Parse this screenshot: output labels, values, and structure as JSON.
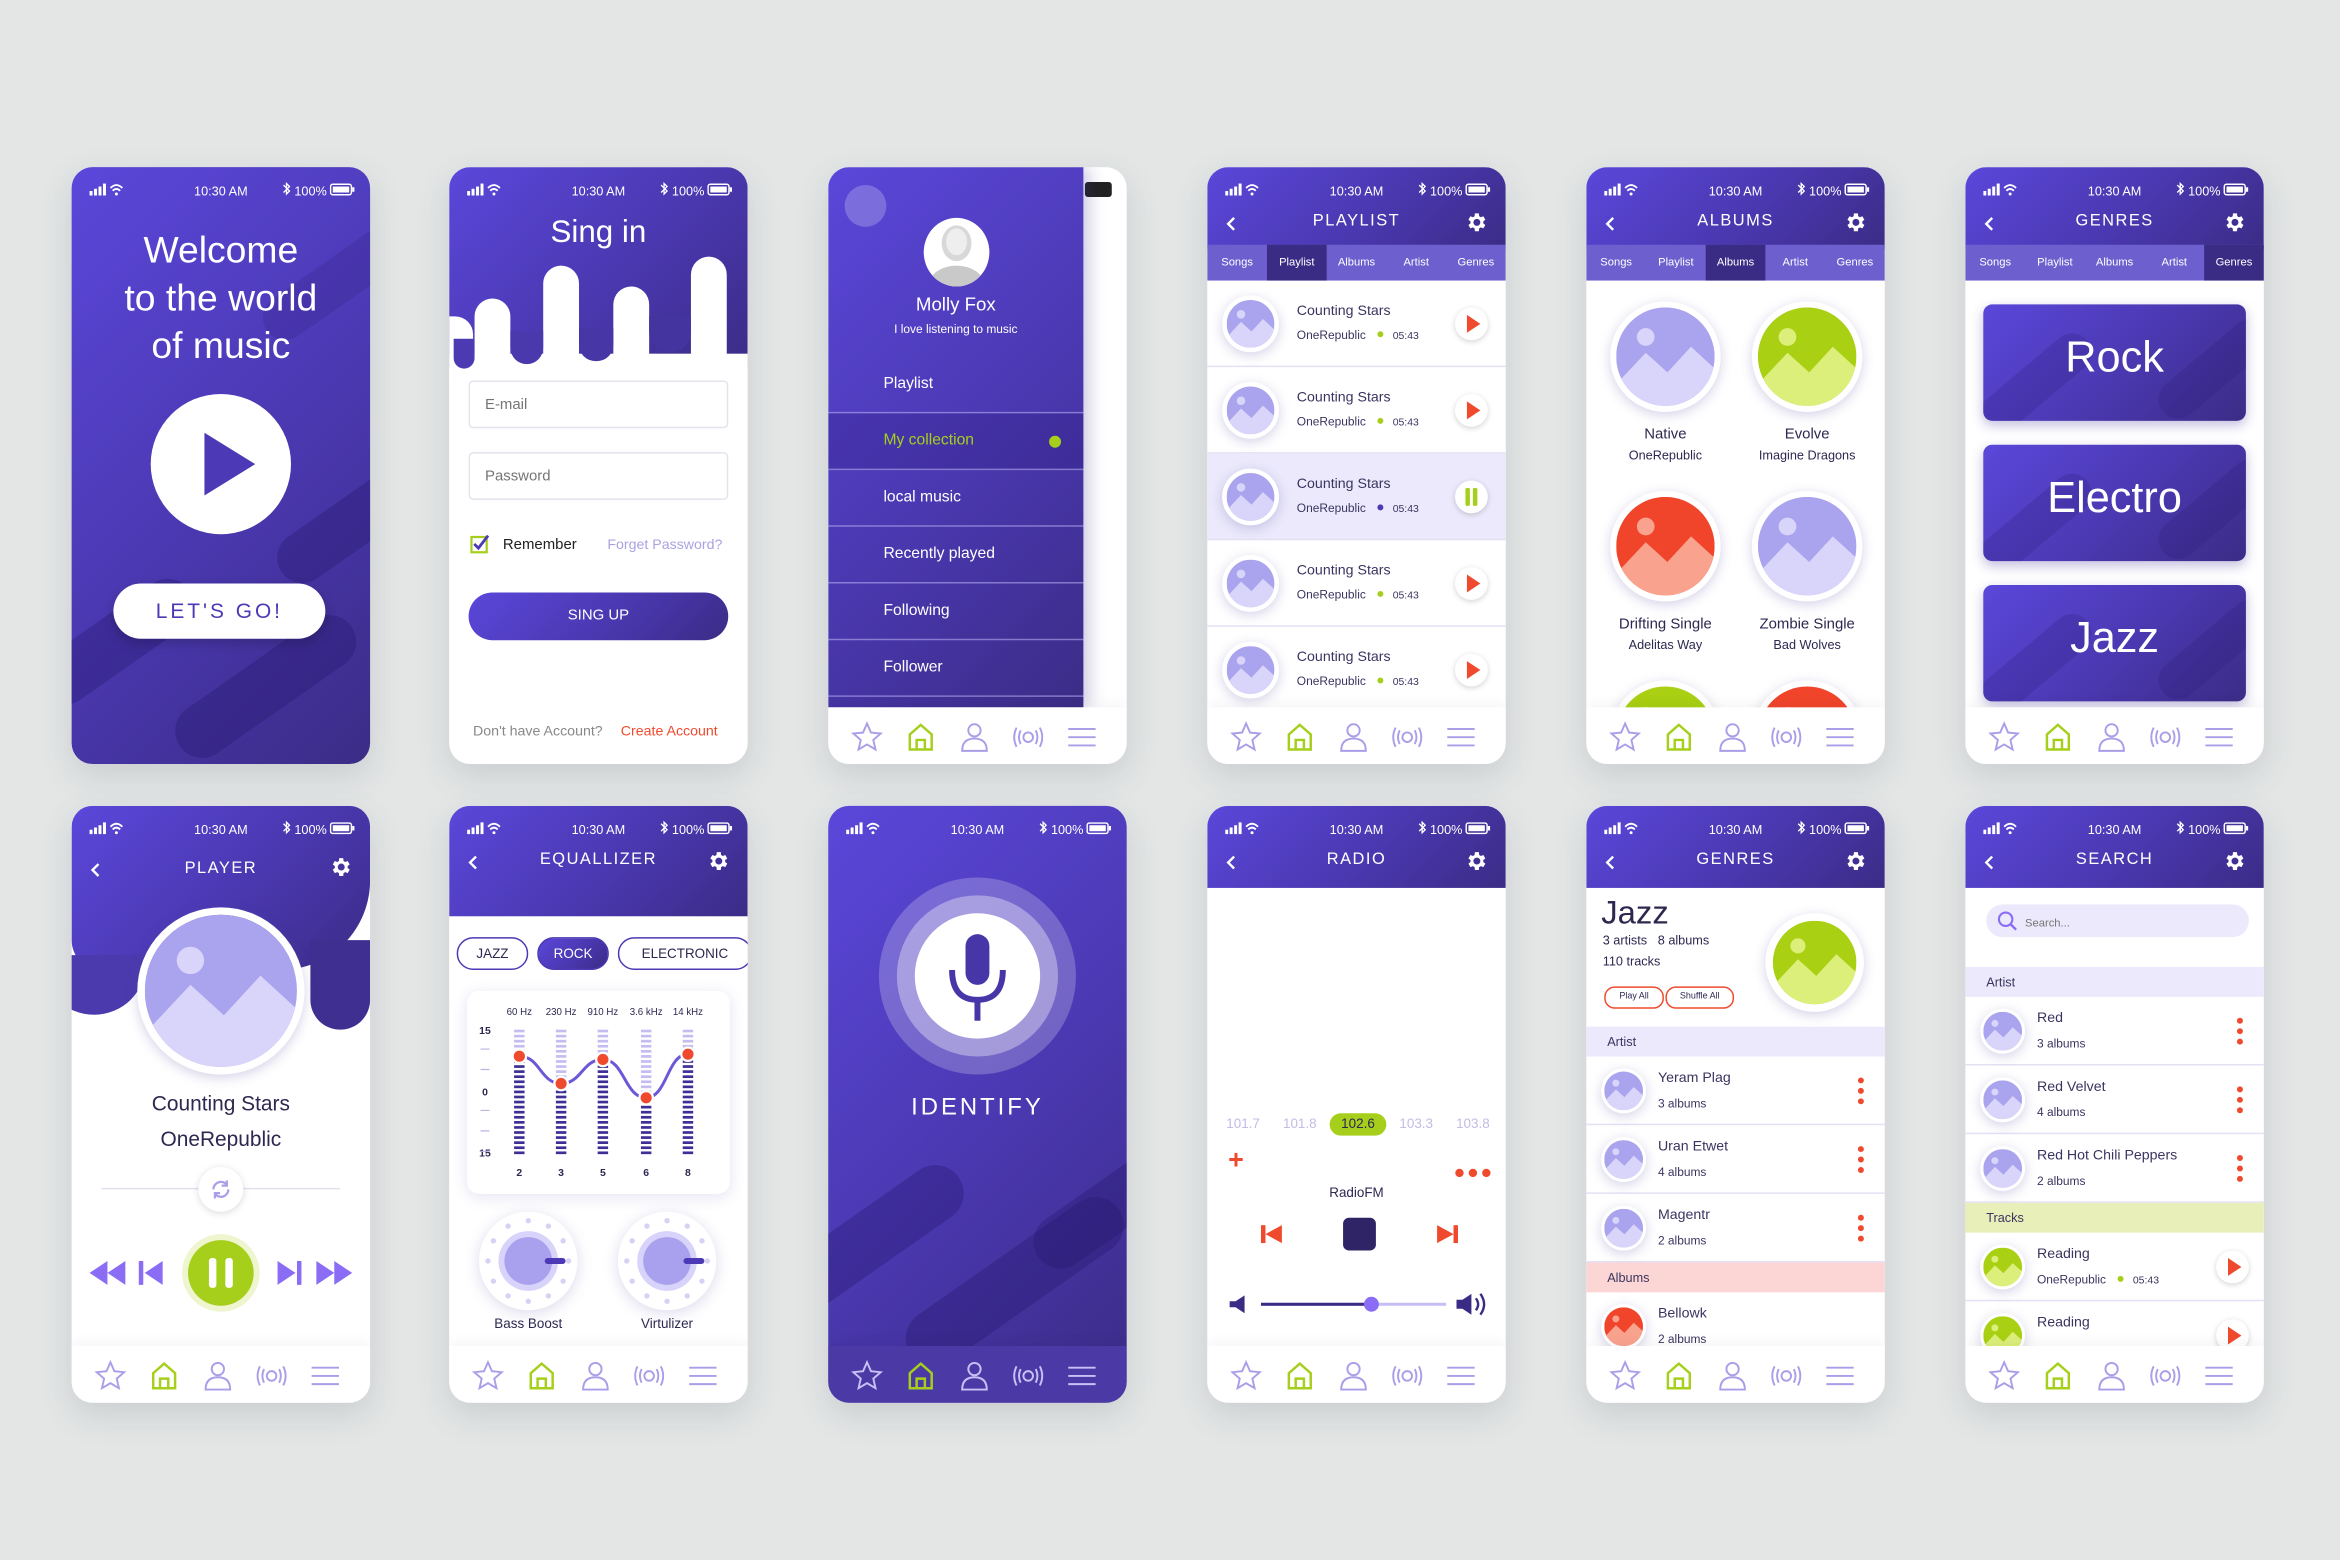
{
  "status": {
    "time": "10:30 AM",
    "battery": "100%"
  },
  "colors": {
    "purple": "#5443c8",
    "dark_purple": "#3a2b85",
    "green": "#a6cf1c",
    "red": "#f04a2e",
    "lavender": "#ebe9fb"
  },
  "palettes": {
    "lavender": [
      "#aaa3ee",
      "#d8d4fa"
    ],
    "green": [
      "#a9d012",
      "#dcef7a"
    ],
    "red": [
      "#f0452b",
      "#f9a38f"
    ]
  },
  "nav_icons": [
    "star-icon",
    "home-icon",
    "user-icon",
    "radio-icon",
    "menu-icon"
  ],
  "welcome": {
    "title_lines": [
      "Welcome",
      "to the world",
      "of music"
    ],
    "cta": "LET'S GO!"
  },
  "signin": {
    "title": "Sing in",
    "email_placeholder": "E-mail",
    "password_placeholder": "Password",
    "remember": "Remember",
    "remember_checked": true,
    "forgot": "Forget Password?",
    "submit": "SING UP",
    "no_account": "Don't have Account?",
    "create": "Create Account"
  },
  "menu": {
    "name": "Molly Fox",
    "bio": "I love listening to music",
    "items": [
      "Playlist",
      "My collection",
      "local music",
      "Recently played",
      "Following",
      "Follower"
    ],
    "active_index": 1
  },
  "tabs": [
    "Songs",
    "Playlist",
    "Albums",
    "Artist",
    "Genres"
  ],
  "playlist": {
    "title": "PLAYLIST",
    "active_tab": 1,
    "tracks": [
      {
        "title": "Counting Stars",
        "artist": "OneRepublic",
        "duration": "05:43",
        "playing": false
      },
      {
        "title": "Counting Stars",
        "artist": "OneRepublic",
        "duration": "05:43",
        "playing": false
      },
      {
        "title": "Counting Stars",
        "artist": "OneRepublic",
        "duration": "05:43",
        "playing": true
      },
      {
        "title": "Counting Stars",
        "artist": "OneRepublic",
        "duration": "05:43",
        "playing": false
      },
      {
        "title": "Counting Stars",
        "artist": "OneRepublic",
        "duration": "05:43",
        "playing": false
      }
    ]
  },
  "albums": {
    "title": "ALBUMS",
    "active_tab": 2,
    "items": [
      {
        "name": "Native",
        "artist": "OneRepublic",
        "palette": "lavender"
      },
      {
        "name": "Evolve",
        "artist": "Imagine Dragons",
        "palette": "green"
      },
      {
        "name": "Drifting Single",
        "artist": "Adelitas Way",
        "palette": "red"
      },
      {
        "name": "Zombie Single",
        "artist": "Bad Wolves",
        "palette": "lavender"
      },
      {
        "name": "",
        "artist": "",
        "palette": "green"
      },
      {
        "name": "",
        "artist": "",
        "palette": "red"
      }
    ]
  },
  "genres": {
    "title": "GENRES",
    "active_tab": 4,
    "items": [
      "Rock",
      "Electro",
      "Jazz"
    ]
  },
  "player": {
    "title": "PLAYER",
    "song": "Counting Stars",
    "artist": "OneRepublic"
  },
  "equalizer": {
    "title": "EQUALLIZER",
    "presets": [
      "JAZZ",
      "ROCK",
      "ELECTRONIC"
    ],
    "active_preset": "ROCK",
    "scale_labels": [
      "15",
      "0",
      "15"
    ],
    "range": [
      -15,
      15
    ],
    "bands": [
      {
        "freq": "60 Hz",
        "label": "2",
        "level": 8.5
      },
      {
        "freq": "230 Hz",
        "label": "3",
        "level": 1.8
      },
      {
        "freq": "910 Hz",
        "label": "5",
        "level": 7.7
      },
      {
        "freq": "3.6 kHz",
        "label": "6",
        "level": -1.7
      },
      {
        "freq": "14 kHz",
        "label": "8",
        "level": 9
      }
    ],
    "knobs": [
      "Bass Boost",
      "Virtulizer"
    ]
  },
  "identify": {
    "label": "IDENTIFY"
  },
  "radio": {
    "title": "RADIO",
    "stations": [
      {
        "freq": "101.7",
        "signal": 0.56
      },
      {
        "freq": "101.8",
        "signal": 0.8
      },
      {
        "freq": "102.6",
        "signal": 1.0
      },
      {
        "freq": "103.3",
        "signal": 0.8
      },
      {
        "freq": "103.8",
        "signal": 0.56
      }
    ],
    "active_station": "102.6",
    "station_name": "RadioFM",
    "volume": 0.6
  },
  "genre_detail": {
    "title": "GENRES",
    "genre": "Jazz",
    "artists": "3 artists",
    "albums_count": "8 albums",
    "tracks": "110 tracks",
    "play_all": "Play All",
    "shuffle_all": "Shuffle All",
    "artist_header": "Artist",
    "artists_list": [
      {
        "name": "Yeram Plag",
        "sub": "3 albums"
      },
      {
        "name": "Uran Etwet",
        "sub": "4 albums"
      },
      {
        "name": "Magentr",
        "sub": "2 albums"
      }
    ],
    "albums_header": "Albums",
    "albums_list": [
      {
        "name": "Bellowk",
        "sub": "2 albums"
      }
    ]
  },
  "search": {
    "title": "SEARCH",
    "placeholder": "Search...",
    "artist_header": "Artist",
    "artists": [
      {
        "name": "Red",
        "sub": "3 albums"
      },
      {
        "name": "Red Velvet",
        "sub": "4 albums"
      },
      {
        "name": "Red Hot Chili Peppers",
        "sub": "2 albums"
      }
    ],
    "tracks_header": "Tracks",
    "tracks": [
      {
        "title": "Reading",
        "artist": "OneRepublic",
        "duration": "05:43"
      },
      {
        "title": "Reading",
        "artist": "",
        "duration": ""
      }
    ]
  }
}
